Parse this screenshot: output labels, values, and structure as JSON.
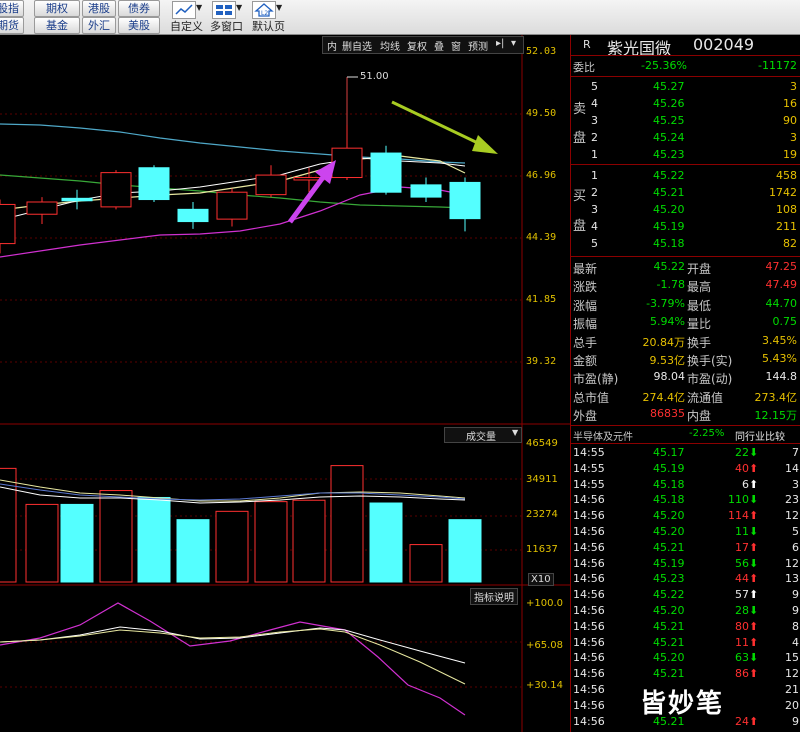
{
  "toolbar": {
    "buttons": [
      "股指",
      "期权",
      "港股",
      "债券",
      "期货",
      "基金",
      "外汇",
      "美股"
    ],
    "tools": [
      "自定义",
      "多窗口",
      "默认页"
    ]
  },
  "chart_controls": [
    "内",
    "删自选",
    "均线",
    "复权",
    "叠",
    "窗",
    "预测",
    "▸|",
    "▾"
  ],
  "price_axis": [
    "52.03",
    "49.50",
    "46.96",
    "44.39",
    "41.85",
    "39.32"
  ],
  "peak_label": "51.00",
  "volume": {
    "title": "成交量",
    "axis": [
      "46549",
      "34911",
      "23274",
      "11637"
    ],
    "unit": "X10"
  },
  "indicator": {
    "title": "指标说明",
    "axis": [
      "+100.0",
      "+65.08",
      "+30.14"
    ]
  },
  "stock": {
    "tag": "R",
    "name": "紫光国微",
    "code": "002049"
  },
  "weibi": {
    "label": "委比",
    "pct": "-25.36%",
    "diff": "-11172"
  },
  "sell_label": [
    "卖",
    "盘"
  ],
  "buy_label": [
    "买",
    "盘"
  ],
  "sell": [
    {
      "n": "5",
      "price": "45.27",
      "vol": "3"
    },
    {
      "n": "4",
      "price": "45.26",
      "vol": "16"
    },
    {
      "n": "3",
      "price": "45.25",
      "vol": "90"
    },
    {
      "n": "2",
      "price": "45.24",
      "vol": "3"
    },
    {
      "n": "1",
      "price": "45.23",
      "vol": "19"
    }
  ],
  "buy": [
    {
      "n": "1",
      "price": "45.22",
      "vol": "458"
    },
    {
      "n": "2",
      "price": "45.21",
      "vol": "1742"
    },
    {
      "n": "3",
      "price": "45.20",
      "vol": "108"
    },
    {
      "n": "4",
      "price": "45.19",
      "vol": "211"
    },
    {
      "n": "5",
      "price": "45.18",
      "vol": "82"
    }
  ],
  "quote": [
    {
      "l1": "最新",
      "v1": "45.22",
      "c1": "green",
      "l2": "开盘",
      "v2": "47.25",
      "c2": "red"
    },
    {
      "l1": "涨跌",
      "v1": "-1.78",
      "c1": "green",
      "l2": "最高",
      "v2": "47.49",
      "c2": "red"
    },
    {
      "l1": "涨幅",
      "v1": "-3.79%",
      "c1": "green",
      "l2": "最低",
      "v2": "44.70",
      "c2": "green"
    },
    {
      "l1": "振幅",
      "v1": "5.94%",
      "c1": "green",
      "l2": "量比",
      "v2": "0.75",
      "c2": "green"
    },
    {
      "l1": "总手",
      "v1": "20.84万",
      "c1": "yellow",
      "l2": "换手",
      "v2": "3.45%",
      "c2": "yellow"
    },
    {
      "l1": "金额",
      "v1": "9.53亿",
      "c1": "yellow",
      "l2": "换手(实)",
      "v2": "5.43%",
      "c2": "yellow"
    },
    {
      "l1": "市盈(静)",
      "v1": "98.04",
      "c1": "white",
      "l2": "市盈(动)",
      "v2": "144.8",
      "c2": "white"
    },
    {
      "l1": "总市值",
      "v1": "274.4亿",
      "c1": "yellow",
      "l2": "流通值",
      "v2": "273.4亿",
      "c2": "yellow"
    },
    {
      "l1": "外盘",
      "v1": "86835",
      "c1": "red",
      "l2": "内盘",
      "v2": "12.15万",
      "c2": "green"
    }
  ],
  "sector": {
    "name": "半导体及元件",
    "pct": "-2.25%",
    "compare": "同行业比较"
  },
  "ticks": [
    {
      "t": "14:55",
      "p": "45.17",
      "pc": "green",
      "v": "22",
      "vc": "green",
      "d": "dn",
      "n": "7"
    },
    {
      "t": "14:55",
      "p": "45.19",
      "pc": "green",
      "v": "40",
      "vc": "red",
      "d": "up",
      "n": "14"
    },
    {
      "t": "14:55",
      "p": "45.18",
      "pc": "green",
      "v": "6",
      "vc": "white",
      "d": "upw",
      "n": "3"
    },
    {
      "t": "14:56",
      "p": "45.18",
      "pc": "green",
      "v": "110",
      "vc": "green",
      "d": "dn",
      "n": "23"
    },
    {
      "t": "14:56",
      "p": "45.20",
      "pc": "green",
      "v": "114",
      "vc": "red",
      "d": "up",
      "n": "12"
    },
    {
      "t": "14:56",
      "p": "45.20",
      "pc": "green",
      "v": "11",
      "vc": "green",
      "d": "dn",
      "n": "5"
    },
    {
      "t": "14:56",
      "p": "45.21",
      "pc": "green",
      "v": "17",
      "vc": "red",
      "d": "up",
      "n": "6"
    },
    {
      "t": "14:56",
      "p": "45.19",
      "pc": "green",
      "v": "56",
      "vc": "green",
      "d": "dn",
      "n": "12"
    },
    {
      "t": "14:56",
      "p": "45.23",
      "pc": "green",
      "v": "44",
      "vc": "red",
      "d": "up",
      "n": "13"
    },
    {
      "t": "14:56",
      "p": "45.22",
      "pc": "green",
      "v": "57",
      "vc": "white",
      "d": "upw",
      "n": "9"
    },
    {
      "t": "14:56",
      "p": "45.20",
      "pc": "green",
      "v": "28",
      "vc": "green",
      "d": "dn",
      "n": "9"
    },
    {
      "t": "14:56",
      "p": "45.21",
      "pc": "green",
      "v": "80",
      "vc": "red",
      "d": "up",
      "n": "8"
    },
    {
      "t": "14:56",
      "p": "45.21",
      "pc": "green",
      "v": "11",
      "vc": "red",
      "d": "up",
      "n": "4"
    },
    {
      "t": "14:56",
      "p": "45.20",
      "pc": "green",
      "v": "63",
      "vc": "green",
      "d": "dn",
      "n": "15"
    },
    {
      "t": "14:56",
      "p": "45.21",
      "pc": "green",
      "v": "86",
      "vc": "red",
      "d": "up",
      "n": "12"
    },
    {
      "t": "14:56",
      "p": "",
      "pc": "green",
      "v": "",
      "vc": "red",
      "d": "",
      "n": "21"
    },
    {
      "t": "14:56",
      "p": "",
      "pc": "green",
      "v": "",
      "vc": "red",
      "d": "",
      "n": "20"
    },
    {
      "t": "14:56",
      "p": "45.21",
      "pc": "green",
      "v": "24",
      "vc": "red",
      "d": "up",
      "n": "9"
    }
  ],
  "watermark": "皆妙笔",
  "colors": {
    "up": "#ff3030",
    "down": "#00dc00",
    "cyan": "#54ffff",
    "axis": "#e0c000"
  }
}
